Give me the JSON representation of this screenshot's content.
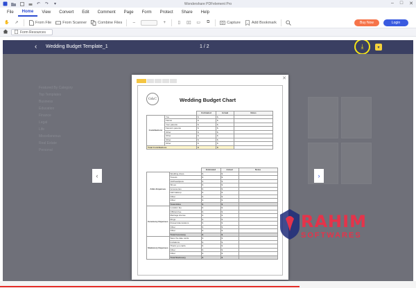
{
  "app": {
    "window_title": "Wondershare PDFelement Pro"
  },
  "menu": [
    "File",
    "Home",
    "View",
    "Convert",
    "Edit",
    "Comment",
    "Page",
    "Form",
    "Protect",
    "Share",
    "Help"
  ],
  "account": {
    "buy_label": "Buy Now",
    "login_label": "Login"
  },
  "toolbar": {
    "from_file": "From File",
    "from_scanner": "From Scanner",
    "combine_files": "Combine Files",
    "capture": "Capture",
    "add_bookmark": "Add Bookmark"
  },
  "tab": {
    "label": "Form Resources"
  },
  "viewer": {
    "doc_title": "Wedding Budget Template_1",
    "pager": "1 / 2"
  },
  "ghost_sidebar": [
    "Featured By Category",
    "Top Templates",
    "Business",
    "Education",
    "Finance",
    "Legal",
    "Life",
    "Miscellaneous",
    "Real Estate",
    "Personal"
  ],
  "preview": {
    "tabs": [
      "",
      "",
      "",
      "",
      ""
    ],
    "logo_text": "G&C",
    "title": "Wedding Budget Chart",
    "headers": [
      "Estimated",
      "Actual",
      "Notes"
    ],
    "headers2": [
      "Estimated",
      "Actual",
      "Notes"
    ],
    "contrib": {
      "label": "Contributions",
      "rows": [
        "You",
        "Fiancé",
        "Your parents",
        "Fiancé's parents",
        "Other",
        "Other",
        "Other",
        "Other"
      ],
      "total": "Total Contributions"
    },
    "attire": {
      "label": "Attire Expenses",
      "rows": [
        "Wedding dress",
        "Tuxedo",
        "Veil/headpiece",
        "Shoes",
        "Accessories",
        "Hairmakeup",
        "Other",
        "Other"
      ],
      "total": "Total Attire"
    },
    "ceremony": {
      "label": "Ceremony Expenses",
      "rows": [
        "Location fee",
        "Officiant fee",
        "Marriage license",
        "Rings",
        "Flowers/decorations",
        "Other",
        "Other"
      ],
      "total": "Total Ceremony"
    },
    "stationery": {
      "label": "Stationery Expenses",
      "rows": [
        "Save the date cards",
        "Invitations",
        "Thank you cards",
        "Other",
        "Other"
      ],
      "total": "Total Stationery"
    },
    "currency": "$"
  },
  "watermark": {
    "line1": "RAHIM",
    "line2": "SOFTWARES"
  }
}
